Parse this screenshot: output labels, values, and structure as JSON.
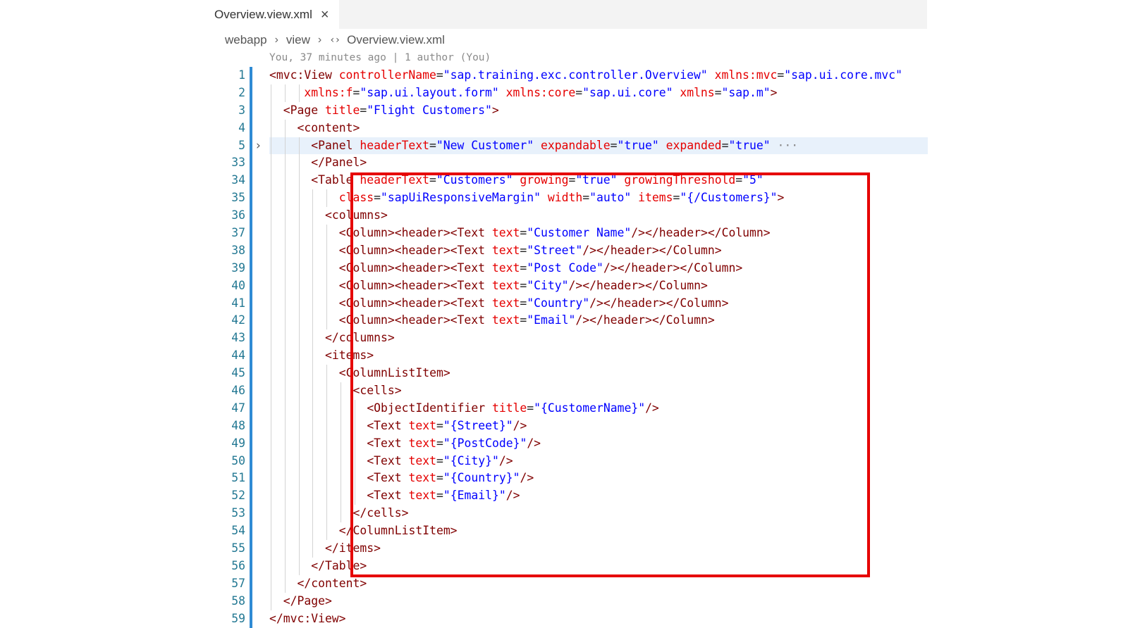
{
  "tab": {
    "label": "Overview.view.xml",
    "close_glyph": "×"
  },
  "breadcrumb": {
    "items": [
      "webapp",
      "view",
      "Overview.view.xml"
    ],
    "separator": "›",
    "file_icon": "xml-brackets-icon"
  },
  "blame": "You, 37 minutes ago | 1 author (You)",
  "colors": {
    "tag": "#800000",
    "attribute": "#e50000",
    "value": "#0000ff",
    "line_number": "#237893",
    "highlight_border": "#e60000"
  },
  "code": {
    "lines": [
      {
        "n": "1",
        "indent": 0,
        "tokens": [
          [
            "tag",
            "<mvc:View"
          ],
          [
            "sp",
            " "
          ],
          [
            "attr",
            "controllerName"
          ],
          [
            "punct",
            "="
          ],
          [
            "val",
            "\"sap.training.exc.controller.Overview\""
          ],
          [
            "sp",
            " "
          ],
          [
            "attr",
            "xmlns:mvc"
          ],
          [
            "punct",
            "="
          ],
          [
            "val",
            "\"sap.ui.core.mvc\""
          ]
        ]
      },
      {
        "n": "2",
        "indent": 5,
        "tokens": [
          [
            "attr",
            "xmlns:f"
          ],
          [
            "punct",
            "="
          ],
          [
            "val",
            "\"sap.ui.layout.form\""
          ],
          [
            "sp",
            " "
          ],
          [
            "attr",
            "xmlns:core"
          ],
          [
            "punct",
            "="
          ],
          [
            "val",
            "\"sap.ui.core\""
          ],
          [
            "sp",
            " "
          ],
          [
            "attr",
            "xmlns"
          ],
          [
            "punct",
            "="
          ],
          [
            "val",
            "\"sap.m\""
          ],
          [
            "tag",
            ">"
          ]
        ]
      },
      {
        "n": "3",
        "indent": 2,
        "tokens": [
          [
            "tag",
            "<Page"
          ],
          [
            "sp",
            " "
          ],
          [
            "attr",
            "title"
          ],
          [
            "punct",
            "="
          ],
          [
            "val",
            "\"Flight Customers\""
          ],
          [
            "tag",
            ">"
          ]
        ]
      },
      {
        "n": "4",
        "indent": 4,
        "tokens": [
          [
            "tag",
            "<content>"
          ]
        ]
      },
      {
        "n": "5",
        "indent": 6,
        "folded": true,
        "tokens": [
          [
            "tag",
            "<Panel"
          ],
          [
            "sp",
            " "
          ],
          [
            "attr",
            "headerText"
          ],
          [
            "punct",
            "="
          ],
          [
            "val",
            "\"New Customer\""
          ],
          [
            "sp",
            " "
          ],
          [
            "attr",
            "expandable"
          ],
          [
            "punct",
            "="
          ],
          [
            "val",
            "\"true\""
          ],
          [
            "sp",
            " "
          ],
          [
            "attr",
            "expanded"
          ],
          [
            "punct",
            "="
          ],
          [
            "val",
            "\"true\""
          ],
          [
            "ellipsis",
            " ···"
          ]
        ]
      },
      {
        "n": "33",
        "indent": 6,
        "tokens": [
          [
            "tag",
            "</Panel>"
          ]
        ]
      },
      {
        "n": "34",
        "indent": 6,
        "tokens": [
          [
            "tag",
            "<Table"
          ],
          [
            "sp",
            " "
          ],
          [
            "attr",
            "headerText"
          ],
          [
            "punct",
            "="
          ],
          [
            "val",
            "\"Customers\""
          ],
          [
            "sp",
            " "
          ],
          [
            "attr",
            "growing"
          ],
          [
            "punct",
            "="
          ],
          [
            "val",
            "\"true\""
          ],
          [
            "sp",
            " "
          ],
          [
            "attr",
            "growingThreshold"
          ],
          [
            "punct",
            "="
          ],
          [
            "val",
            "\"5\""
          ]
        ]
      },
      {
        "n": "35",
        "indent": 10,
        "tokens": [
          [
            "attr",
            "class"
          ],
          [
            "punct",
            "="
          ],
          [
            "val",
            "\"sapUiResponsiveMargin\""
          ],
          [
            "sp",
            " "
          ],
          [
            "attr",
            "width"
          ],
          [
            "punct",
            "="
          ],
          [
            "val",
            "\"auto\""
          ],
          [
            "sp",
            " "
          ],
          [
            "attr",
            "items"
          ],
          [
            "punct",
            "="
          ],
          [
            "val",
            "\"{/Customers}\""
          ],
          [
            "tag",
            ">"
          ]
        ]
      },
      {
        "n": "36",
        "indent": 8,
        "tokens": [
          [
            "tag",
            "<columns>"
          ]
        ]
      },
      {
        "n": "37",
        "indent": 10,
        "tokens": [
          [
            "tag",
            "<Column><header><Text"
          ],
          [
            "sp",
            " "
          ],
          [
            "attr",
            "text"
          ],
          [
            "punct",
            "="
          ],
          [
            "val",
            "\"Customer Name\""
          ],
          [
            "tag",
            "/></header></Column>"
          ]
        ]
      },
      {
        "n": "38",
        "indent": 10,
        "tokens": [
          [
            "tag",
            "<Column><header><Text"
          ],
          [
            "sp",
            " "
          ],
          [
            "attr",
            "text"
          ],
          [
            "punct",
            "="
          ],
          [
            "val",
            "\"Street\""
          ],
          [
            "tag",
            "/></header></Column>"
          ]
        ]
      },
      {
        "n": "39",
        "indent": 10,
        "tokens": [
          [
            "tag",
            "<Column><header><Text"
          ],
          [
            "sp",
            " "
          ],
          [
            "attr",
            "text"
          ],
          [
            "punct",
            "="
          ],
          [
            "val",
            "\"Post Code\""
          ],
          [
            "tag",
            "/></header></Column>"
          ]
        ]
      },
      {
        "n": "40",
        "indent": 10,
        "tokens": [
          [
            "tag",
            "<Column><header><Text"
          ],
          [
            "sp",
            " "
          ],
          [
            "attr",
            "text"
          ],
          [
            "punct",
            "="
          ],
          [
            "val",
            "\"City\""
          ],
          [
            "tag",
            "/></header></Column>"
          ]
        ]
      },
      {
        "n": "41",
        "indent": 10,
        "tokens": [
          [
            "tag",
            "<Column><header><Text"
          ],
          [
            "sp",
            " "
          ],
          [
            "attr",
            "text"
          ],
          [
            "punct",
            "="
          ],
          [
            "val",
            "\"Country\""
          ],
          [
            "tag",
            "/></header></Column>"
          ]
        ]
      },
      {
        "n": "42",
        "indent": 10,
        "tokens": [
          [
            "tag",
            "<Column><header><Text"
          ],
          [
            "sp",
            " "
          ],
          [
            "attr",
            "text"
          ],
          [
            "punct",
            "="
          ],
          [
            "val",
            "\"Email\""
          ],
          [
            "tag",
            "/></header></Column>"
          ]
        ]
      },
      {
        "n": "43",
        "indent": 8,
        "tokens": [
          [
            "tag",
            "</columns>"
          ]
        ]
      },
      {
        "n": "44",
        "indent": 8,
        "tokens": [
          [
            "tag",
            "<items>"
          ]
        ]
      },
      {
        "n": "45",
        "indent": 10,
        "tokens": [
          [
            "tag",
            "<ColumnListItem>"
          ]
        ]
      },
      {
        "n": "46",
        "indent": 12,
        "tokens": [
          [
            "tag",
            "<cells>"
          ]
        ]
      },
      {
        "n": "47",
        "indent": 14,
        "tokens": [
          [
            "tag",
            "<ObjectIdentifier"
          ],
          [
            "sp",
            " "
          ],
          [
            "attr",
            "title"
          ],
          [
            "punct",
            "="
          ],
          [
            "val",
            "\"{CustomerName}\""
          ],
          [
            "tag",
            "/>"
          ]
        ]
      },
      {
        "n": "48",
        "indent": 14,
        "tokens": [
          [
            "tag",
            "<Text"
          ],
          [
            "sp",
            " "
          ],
          [
            "attr",
            "text"
          ],
          [
            "punct",
            "="
          ],
          [
            "val",
            "\"{Street}\""
          ],
          [
            "tag",
            "/>"
          ]
        ]
      },
      {
        "n": "49",
        "indent": 14,
        "tokens": [
          [
            "tag",
            "<Text"
          ],
          [
            "sp",
            " "
          ],
          [
            "attr",
            "text"
          ],
          [
            "punct",
            "="
          ],
          [
            "val",
            "\"{PostCode}\""
          ],
          [
            "tag",
            "/>"
          ]
        ]
      },
      {
        "n": "50",
        "indent": 14,
        "tokens": [
          [
            "tag",
            "<Text"
          ],
          [
            "sp",
            " "
          ],
          [
            "attr",
            "text"
          ],
          [
            "punct",
            "="
          ],
          [
            "val",
            "\"{City}\""
          ],
          [
            "tag",
            "/>"
          ]
        ]
      },
      {
        "n": "51",
        "indent": 14,
        "tokens": [
          [
            "tag",
            "<Text"
          ],
          [
            "sp",
            " "
          ],
          [
            "attr",
            "text"
          ],
          [
            "punct",
            "="
          ],
          [
            "val",
            "\"{Country}\""
          ],
          [
            "tag",
            "/>"
          ]
        ]
      },
      {
        "n": "52",
        "indent": 14,
        "tokens": [
          [
            "tag",
            "<Text"
          ],
          [
            "sp",
            " "
          ],
          [
            "attr",
            "text"
          ],
          [
            "punct",
            "="
          ],
          [
            "val",
            "\"{Email}\""
          ],
          [
            "tag",
            "/>"
          ]
        ]
      },
      {
        "n": "53",
        "indent": 12,
        "tokens": [
          [
            "tag",
            "</cells>"
          ]
        ]
      },
      {
        "n": "54",
        "indent": 10,
        "tokens": [
          [
            "tag",
            "</ColumnListItem>"
          ]
        ]
      },
      {
        "n": "55",
        "indent": 8,
        "tokens": [
          [
            "tag",
            "</items>"
          ]
        ]
      },
      {
        "n": "56",
        "indent": 6,
        "tokens": [
          [
            "tag",
            "</Table>"
          ]
        ]
      },
      {
        "n": "57",
        "indent": 4,
        "tokens": [
          [
            "tag",
            "</content>"
          ]
        ]
      },
      {
        "n": "58",
        "indent": 2,
        "tokens": [
          [
            "tag",
            "</Page>"
          ]
        ]
      },
      {
        "n": "59",
        "indent": 0,
        "tokens": [
          [
            "tag",
            "</mvc:View>"
          ]
        ]
      }
    ]
  }
}
